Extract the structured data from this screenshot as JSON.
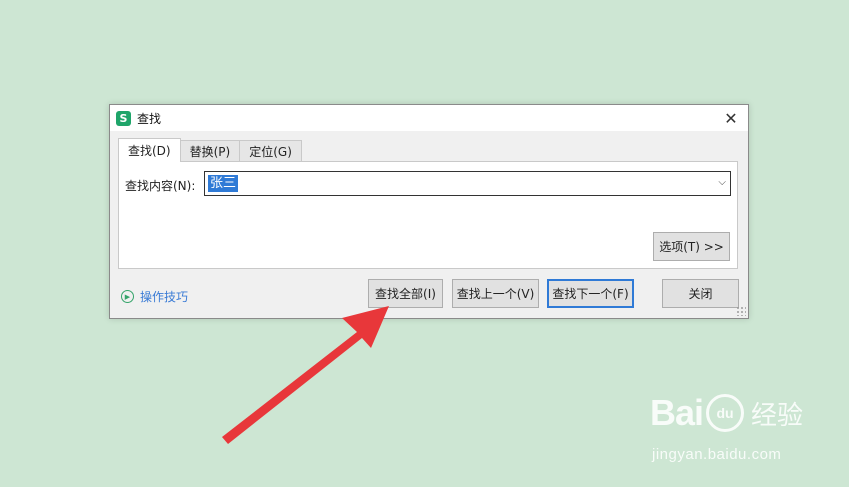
{
  "window": {
    "title": "查找",
    "app_icon_letter": "S",
    "close_symbol": "✕"
  },
  "tabs": [
    {
      "label": "查找(D)",
      "active": true
    },
    {
      "label": "替换(P)",
      "active": false
    },
    {
      "label": "定位(G)",
      "active": false
    }
  ],
  "find": {
    "label": "查找内容(N):",
    "value": "张三",
    "dropdown_symbol": "⌵"
  },
  "buttons": {
    "options": "选项(T) >>",
    "find_all": "查找全部(I)",
    "find_prev": "查找上一个(V)",
    "find_next": "查找下一个(F)",
    "close": "关闭"
  },
  "tips": {
    "icon_symbol": "▶",
    "label": "操作技巧"
  },
  "colors": {
    "background": "#cde6d3",
    "arrow": "#e8373a",
    "accent": "#2f7ad6",
    "app_icon": "#1fa56a"
  },
  "watermark": {
    "logo_left": "Bai",
    "logo_paw": "du",
    "logo_right": "经验",
    "url": "jingyan.baidu.com"
  }
}
